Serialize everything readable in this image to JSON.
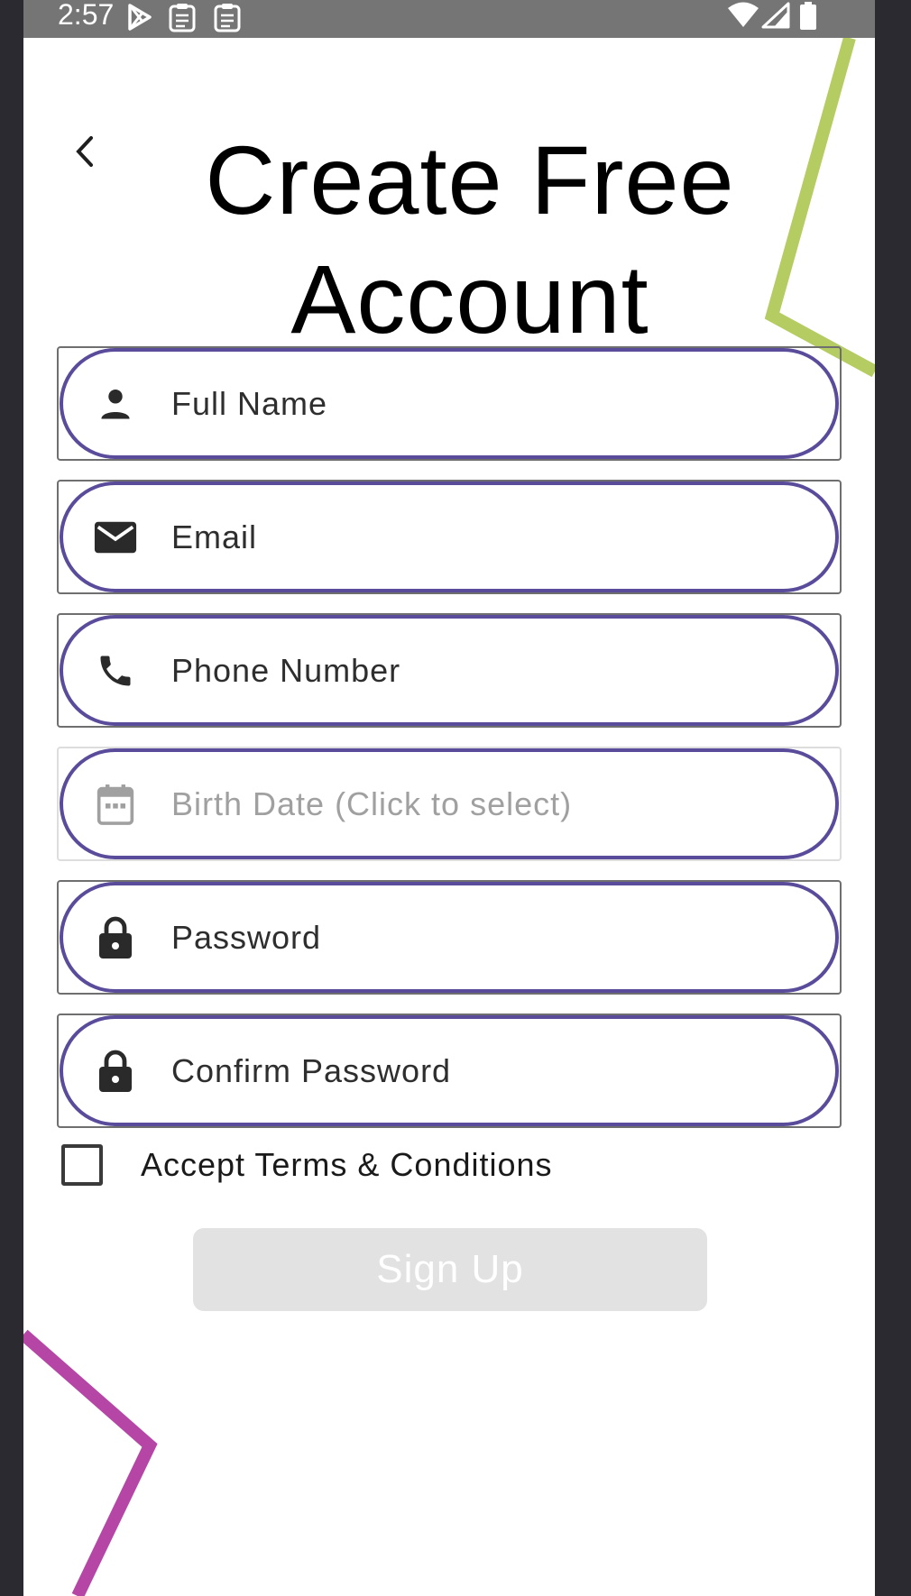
{
  "status_bar": {
    "time": "2:57",
    "left_icons": [
      "play-store-icon",
      "clipboard-icon",
      "clipboard-icon"
    ],
    "right_icons": [
      "wifi-icon",
      "signal-icon",
      "battery-icon"
    ]
  },
  "header": {
    "back_icon": "chevron-left-icon",
    "title": "Create Free Account"
  },
  "form": {
    "fields": [
      {
        "icon": "person-icon",
        "placeholder": "Full Name",
        "enabled": true
      },
      {
        "icon": "email-icon",
        "placeholder": "Email",
        "enabled": true
      },
      {
        "icon": "phone-icon",
        "placeholder": "Phone Number",
        "enabled": true
      },
      {
        "icon": "calendar-icon",
        "placeholder": "Birth Date (Click to select)",
        "enabled": false
      },
      {
        "icon": "lock-icon",
        "placeholder": "Password",
        "enabled": true
      },
      {
        "icon": "lock-icon",
        "placeholder": "Confirm Password",
        "enabled": true
      }
    ],
    "terms": {
      "label": "Accept Terms & Conditions",
      "checked": false
    },
    "submit": {
      "label": "Sign Up",
      "enabled": false
    }
  },
  "colors": {
    "field_outline": "#5a4c9a",
    "deco_green": "#b5cc62",
    "deco_magenta": "#b546a6",
    "button_disabled": "#e2e2e2"
  }
}
